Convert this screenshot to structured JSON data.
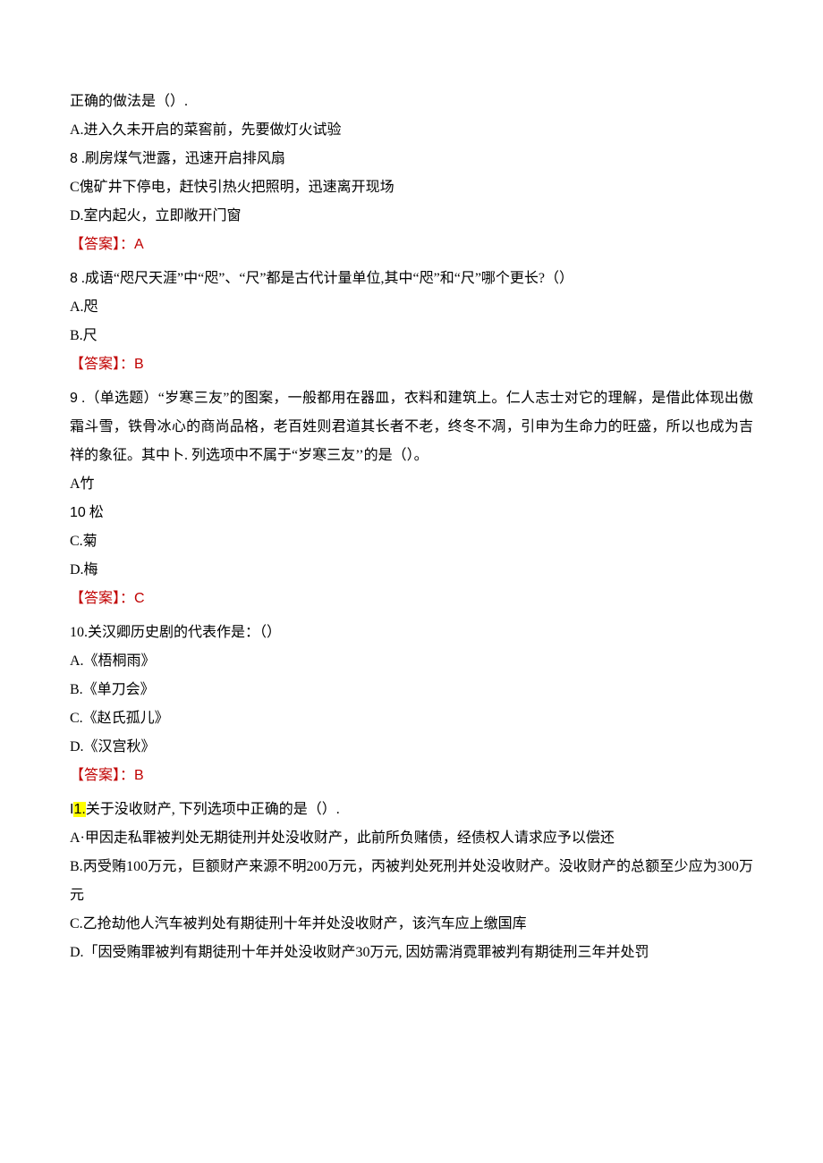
{
  "q7": {
    "stem": "正确的做法是（）.",
    "A": "A.进入久未开启的菜窖前，先要做灯火试验",
    "B_num": "8",
    "B_text": " .刷房煤气泄露，迅速开启排风扇",
    "C": "C傀矿井下停电，赶快引热火把照明，迅速离开现场",
    "D": "D.室内起火，立即敞开门窗",
    "ans_label": "【答案】：",
    "ans_letter": "A"
  },
  "q8": {
    "num": "8",
    "stem": " .成语“咫尺天涯”中“咫”、“尺”都是古代计量单位,其中“咫”和“尺”哪个更长?（）",
    "A": "A.咫",
    "B": "B.尺",
    "ans_label": "【答案】：",
    "ans_letter": "B"
  },
  "q9": {
    "num": "9",
    "stem": " .（单选题）“岁寒三友”的图案，一般都用在器皿，衣料和建筑上。仁人志士对它的理解，是借此体现出傲霜斗雪，铁骨冰心的商尚品格，老百姓则君道其长者不老，终冬不凋，引申为生命力的旺盛，所以也成为吉祥的象征。其中卜. 列选项中不属于“岁寒三友’’的是（）。",
    "A": "A竹",
    "B_num": "10",
    "B_text": " 松",
    "C": "C.菊",
    "D": "D.梅",
    "ans_label": "【答案】：",
    "ans_letter": "C"
  },
  "q10": {
    "stem": "10.关汉卿历史剧的代表作是：（）",
    "A": "A.《梧桐雨》",
    "B": "B.《单刀会》",
    "C": "C.《赵氏孤儿》",
    "D": "D.《汉宫秋》",
    "ans_label": "【答案】：",
    "ans_letter": "B"
  },
  "q11": {
    "num_prefix": "I",
    "num_hl": "1.",
    "stem": "关于没收财产, 下列选项中正确的是（）.",
    "A": "A·甲因走私罪被判处无期徒刑并处没收财产，此前所负赌债，经债权人请求应予以偿还",
    "B": "B.丙受贿100万元，巨额财产来源不明200万元，丙被判处死刑并处没收财产。没收财产的总额至少应为300万元",
    "C": "C.乙抢劫他人汽车被判处有期徒刑十年并处没收财产，该汽车应上缴国库",
    "D": "D.「因受贿罪被判有期徒刑十年并处没收财产30万元, 因妨需消霓罪被判有期徒刑三年并处罚"
  }
}
